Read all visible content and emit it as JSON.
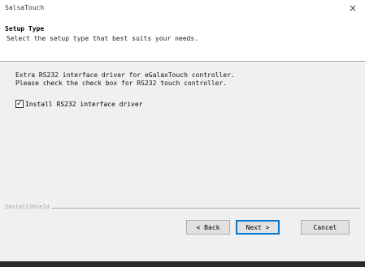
{
  "window": {
    "title": "SalsaTouch",
    "close_glyph": "×"
  },
  "header": {
    "title": "Setup Type",
    "subtitle": "Select the setup type that best suits your needs."
  },
  "content": {
    "description": [
      "Extra RS232 interface driver for eGalaxTouch controller.",
      "Please check the check box for RS232 touch controller."
    ],
    "checkbox": {
      "label": "Install RS232 interface driver",
      "checked": true,
      "check_glyph": "✓"
    }
  },
  "footer": {
    "group_label": "InstallShield"
  },
  "buttons": {
    "back": "< Back",
    "next": "Next >",
    "cancel": "Cancel"
  },
  "colors": {
    "window_bg": "#f0f0f0",
    "header_bg": "#ffffff",
    "default_button_border": "#0078d7",
    "taskbar": "#2b2b2b"
  }
}
